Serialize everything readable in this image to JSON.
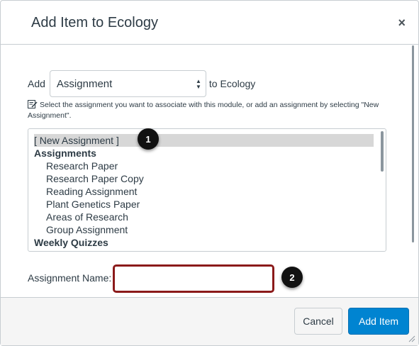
{
  "dialog": {
    "title": "Add Item to Ecology",
    "close_label": "×"
  },
  "add_row": {
    "prefix": "Add",
    "select_value": "Assignment",
    "suffix": "to Ecology"
  },
  "hint": {
    "text": "Select the assignment you want to associate with this module, or add an assignment by selecting \"New Assignment\"."
  },
  "listbox": {
    "items": [
      {
        "label": "[ New Assignment ]",
        "kind": "option",
        "selected": true
      },
      {
        "label": "Assignments",
        "kind": "group"
      },
      {
        "label": "Research Paper",
        "kind": "option"
      },
      {
        "label": "Research Paper Copy",
        "kind": "option"
      },
      {
        "label": "Reading Assignment",
        "kind": "option"
      },
      {
        "label": "Plant Genetics Paper",
        "kind": "option"
      },
      {
        "label": "Areas of Research",
        "kind": "option"
      },
      {
        "label": "Group Assignment",
        "kind": "option"
      },
      {
        "label": "Weekly Quizzes",
        "kind": "group"
      }
    ]
  },
  "name_field": {
    "label": "Assignment Name:",
    "value": "",
    "highlight_color": "#8b1a1a"
  },
  "callouts": {
    "one": "1",
    "two": "2"
  },
  "footer": {
    "cancel_label": "Cancel",
    "add_label": "Add Item",
    "primary_color": "#0084d1"
  }
}
